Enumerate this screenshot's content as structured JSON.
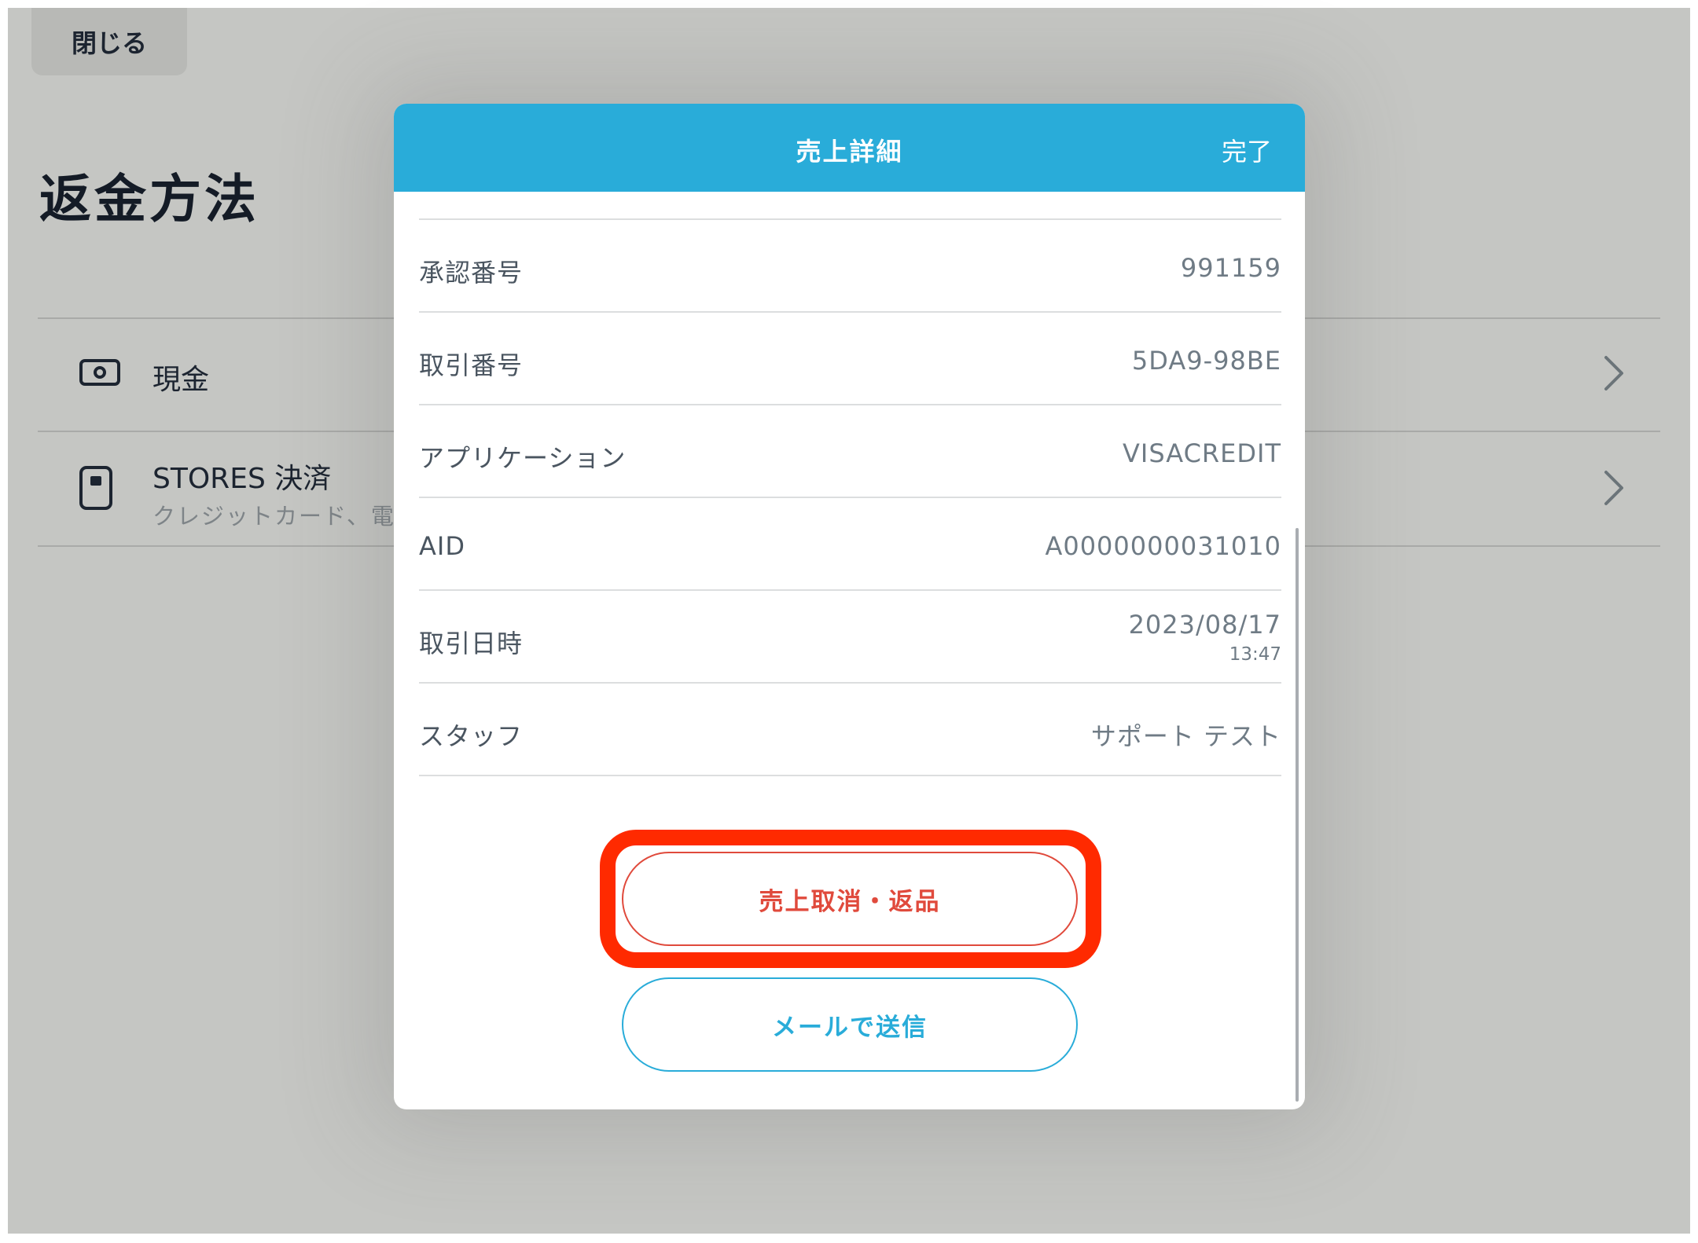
{
  "background": {
    "close_button": "閉じる",
    "page_title": "返金方法",
    "methods": [
      {
        "label": "現金",
        "icon": "cash-icon"
      },
      {
        "label": "STORES 決済",
        "sub": "クレジットカード、電子マ",
        "icon": "card-reader-icon"
      }
    ]
  },
  "modal": {
    "title": "売上詳細",
    "done_label": "完了",
    "rows": [
      {
        "label": "承認番号",
        "value": "991159"
      },
      {
        "label": "取引番号",
        "value": "5DA9-98BE"
      },
      {
        "label": "アプリケーション",
        "value": "VISACREDIT"
      },
      {
        "label": "AID",
        "value": "A0000000031010"
      },
      {
        "label": "取引日時",
        "value": "2023/08/17",
        "time": "13:47"
      },
      {
        "label": "スタッフ",
        "value": "サポート テスト"
      }
    ],
    "refund_button": "売上取消・返品",
    "mail_button": "メールで送信"
  },
  "colors": {
    "accent": "#29acd9",
    "danger": "#e04a3c",
    "highlight": "#ff2a00"
  }
}
